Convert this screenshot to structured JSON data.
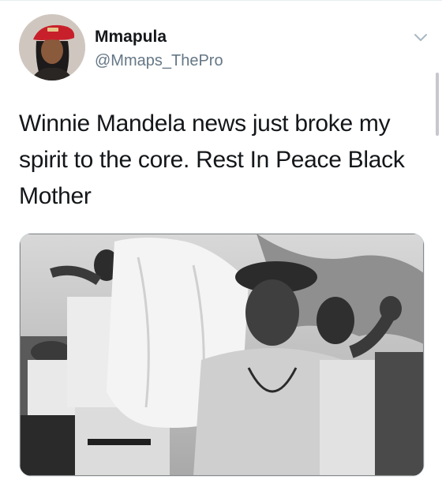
{
  "user": {
    "display_name": "Mmapula",
    "handle": "@Mmaps_ThePro",
    "avatar_icon": "profile-photo-red-beret"
  },
  "tweet": {
    "text": "Winnie Mandela news just broke my spirit to the core. Rest In Peace Black Mother"
  },
  "media": {
    "type": "black-and-white photograph",
    "icon": "photo"
  },
  "colors": {
    "text_primary": "#14171a",
    "text_secondary": "#657786",
    "divider": "#e6ecf0",
    "caret": "#aab8c2"
  }
}
